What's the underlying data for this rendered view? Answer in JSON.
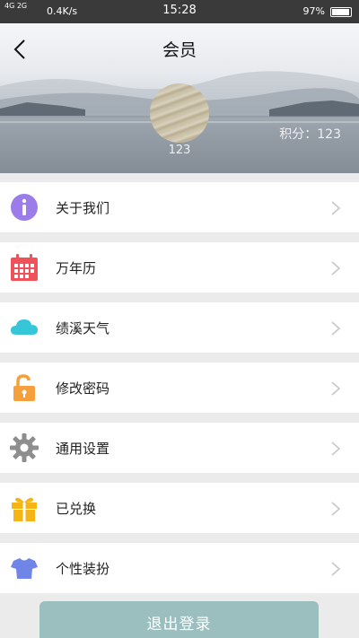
{
  "status_bar": {
    "network": "4G 2G",
    "speed": "0.4K/s",
    "time": "15:28",
    "battery": "97%"
  },
  "header": {
    "title": "会员",
    "username": "123",
    "points": "积分：123"
  },
  "menu": [
    {
      "label": "关于我们",
      "icon": "info-icon",
      "color": "#9b7ce8"
    },
    {
      "label": "万年历",
      "icon": "calendar-icon",
      "color": "#f0525a"
    },
    {
      "label": "绩溪天气",
      "icon": "cloud-icon",
      "color": "#35c7d8"
    },
    {
      "label": "修改密码",
      "icon": "unlock-icon",
      "color": "#f5a03c"
    },
    {
      "label": "通用设置",
      "icon": "gear-icon",
      "color": "#8e8e8e"
    },
    {
      "label": "已兑换",
      "icon": "gift-icon",
      "color": "#f6b516"
    },
    {
      "label": "个性装扮",
      "icon": "tshirt-icon",
      "color": "#6f86e8"
    }
  ],
  "logout_label": "退出登录"
}
